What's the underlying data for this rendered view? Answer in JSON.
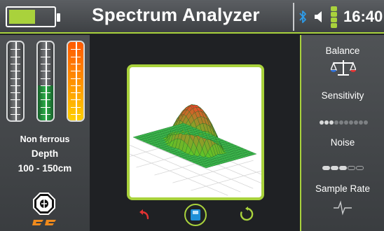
{
  "header": {
    "title": "Spectrum Analyzer",
    "clock": "16:40",
    "battery_level": 0.6,
    "signal_bars": 4
  },
  "left_panel": {
    "meters": [
      {
        "name": "meter-1",
        "level": 0.0
      },
      {
        "name": "meter-2",
        "level": 0.45
      },
      {
        "name": "meter-3",
        "level": 1.0
      }
    ],
    "target_type": "Non ferrous",
    "depth_label": "Depth",
    "depth_value": "100 - 150cm"
  },
  "center": {
    "graph": "3d-surface-peak"
  },
  "right_panel": {
    "balance_label": "Balance",
    "sensitivity_label": "Sensitivity",
    "sensitivity_level": 3,
    "sensitivity_max": 10,
    "noise_label": "Noise",
    "noise_level": 3,
    "noise_max": 5,
    "sample_rate_label": "Sample Rate"
  },
  "icons": {
    "bluetooth": "bluetooth-icon",
    "speaker": "speaker-icon",
    "balance": "scales-icon",
    "sample_rate": "waveform-icon",
    "undo": "undo-arrow-icon",
    "save": "save-disk-icon",
    "redo": "refresh-icon",
    "logo": "brand-logo"
  },
  "colors": {
    "accent": "#a9d23c",
    "panel": "#45484b",
    "background": "#1f2124"
  }
}
